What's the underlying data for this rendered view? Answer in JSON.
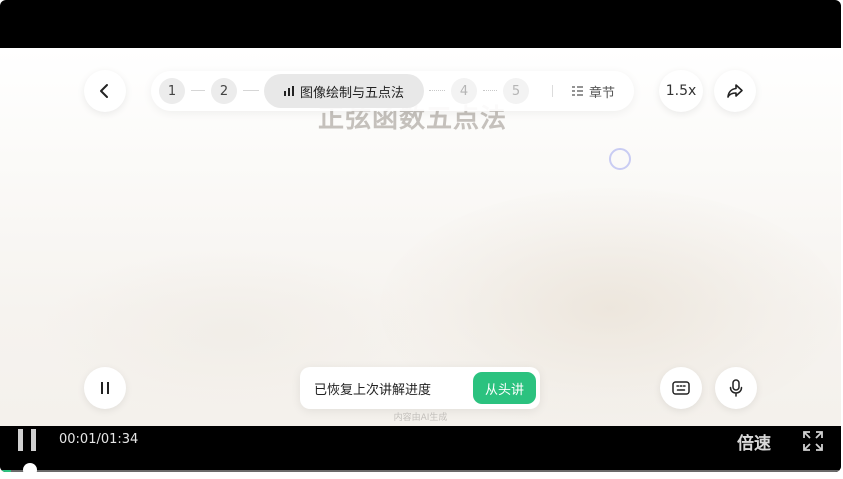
{
  "slide": {
    "title": "正弦函数五点法"
  },
  "chapter_nav": {
    "steps": [
      {
        "label": "1",
        "state": "done"
      },
      {
        "label": "2",
        "state": "done"
      },
      {
        "label": "4",
        "state": "upcoming"
      },
      {
        "label": "5",
        "state": "upcoming"
      }
    ],
    "current": "图像绘制与五点法",
    "chapters_label": "章节"
  },
  "playback": {
    "speed_label": "1.5x",
    "rate_label": "倍速",
    "elapsed": "00:01",
    "duration": "01:34",
    "progress_fraction": 0.011
  },
  "toast": {
    "message": "已恢复上次讲解进度",
    "restart_label": "从头讲"
  },
  "ai_note": "内容由AI生成",
  "colors": {
    "accent": "#2bc27f",
    "background": "#000000"
  },
  "icons": [
    "back-icon",
    "share-icon",
    "pause-icon",
    "subtitle-icon",
    "mic-icon",
    "fullscreen-icon",
    "chapter-list-icon",
    "signal-bars-icon"
  ]
}
